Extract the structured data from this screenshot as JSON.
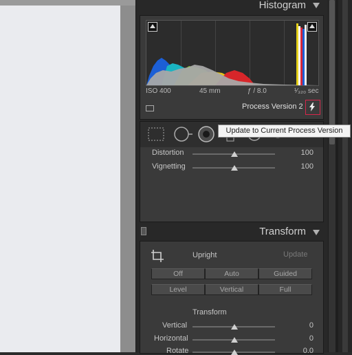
{
  "histogram": {
    "title": "Histogram",
    "iso": "ISO 400",
    "focal": "45 mm",
    "aperture": "ƒ / 8.0",
    "shutter": "¹⁄₃₂₀ sec",
    "process_version": "Process Version 2",
    "update_tooltip": "Update to Current Process Version"
  },
  "lens": {
    "sliders": [
      {
        "label": "Distortion",
        "value": "100",
        "level": 0.5
      },
      {
        "label": "Vignetting",
        "value": "100",
        "level": 0.5
      }
    ]
  },
  "transform": {
    "title": "Transform",
    "upright_label": "Upright",
    "update_label": "Update",
    "buttons_row1": [
      "Off",
      "Auto",
      "Guided"
    ],
    "buttons_row2": [
      "Level",
      "Vertical",
      "Full"
    ],
    "subsection_title": "Transform",
    "sliders": [
      {
        "label": "Vertical",
        "value": "0",
        "level": 0.5
      },
      {
        "label": "Horizontal",
        "value": "0",
        "level": 0.5
      },
      {
        "label": "Rotate",
        "value": "0.0",
        "level": 0.5
      }
    ]
  },
  "colors": {
    "highlight_border": "#d7264a",
    "panel_bg": "#3a3a3a"
  }
}
